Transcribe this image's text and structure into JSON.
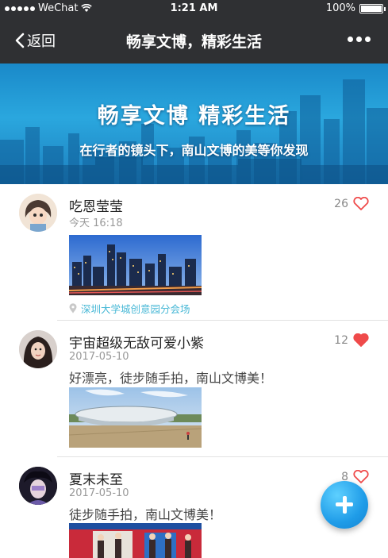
{
  "status_bar": {
    "carrier": "WeChat",
    "time": "1:21 AM",
    "battery": "100%"
  },
  "nav": {
    "back_label": "返回",
    "title": "畅享文博，精彩生活",
    "more_icon": "ellipsis-icon"
  },
  "banner": {
    "title": "畅享文博  精彩生活",
    "subtitle": "在行者的镜头下，南山文博的美等你发现"
  },
  "posts": [
    {
      "username": "吃恩莹莹",
      "time": "今天 16:18",
      "text": "",
      "likes": "26",
      "liked": false,
      "location": "深圳大学城创意园分会场",
      "photo_icon": "city-night-photo"
    },
    {
      "username": "宇宙超级无敌可爱小紫",
      "time": "2017-05-10",
      "text": "好漂亮，徒步随手拍，南山文博美！",
      "likes": "12",
      "liked": true,
      "photo_icon": "stadium-photo"
    },
    {
      "username": "夏末未至",
      "time": "2017-05-10",
      "text": "徒步随手拍，南山文博美！",
      "likes": "8",
      "liked": false,
      "photo_icon": "exhibition-photo"
    }
  ],
  "colors": {
    "nav_bg": "#2f3033",
    "heart": "#ef4a4a",
    "location": "#48b8d6",
    "fab": "#1f9ce8"
  },
  "fab_icon": "plus-icon"
}
